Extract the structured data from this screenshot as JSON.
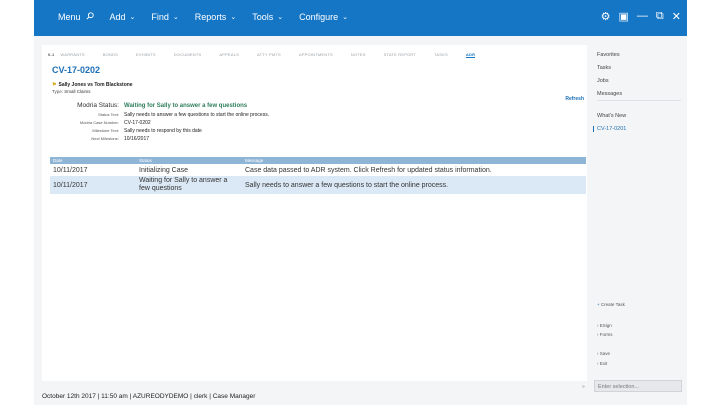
{
  "topbar": {
    "menus": [
      {
        "label": "Menu",
        "icon": "search-icon"
      },
      {
        "label": "Add",
        "icon": "chevron-down-icon"
      },
      {
        "label": "Find",
        "icon": "chevron-down-icon"
      },
      {
        "label": "Reports",
        "icon": "chevron-down-icon"
      },
      {
        "label": "Tools",
        "icon": "chevron-down-icon"
      },
      {
        "label": "Configure",
        "icon": "chevron-down-icon"
      }
    ],
    "window_controls": [
      "gear-icon",
      "screenshot-icon",
      "minimize-icon",
      "restore-icon",
      "close-icon"
    ],
    "color": "#1576c6"
  },
  "tabs": [
    "0-1",
    "WARRANTS",
    "BONDS",
    "EXHIBITS",
    "DOCUMENTS",
    "APPEALS",
    "ATTY PMTS",
    "APPOINTMENTS",
    "NOTES",
    "STATE REPORT",
    "TASKS",
    "ADR"
  ],
  "active_tab": "ADR",
  "case": {
    "number": "CV-17-0202",
    "parties": "Sally Jones vs Tom Blackstone",
    "type_label": "Type:",
    "type_value": "Small Claims"
  },
  "refresh_label": "Refresh",
  "details": {
    "modria_status_label": "Modria Status:",
    "modria_status_value": "Waiting for Sally to answer a few questions",
    "status_text_label": "Status Text:",
    "status_text_value": "Sally needs to answer a few questions to start the online process.",
    "case_number_label": "Modria Case Number:",
    "case_number_value": "CV-17-0202",
    "milestone_text_label": "Milestone Text:",
    "milestone_text_value": "Sally needs to respond by this date",
    "next_milestone_label": "Next Milestone:",
    "next_milestone_value": "10/16/2017"
  },
  "table": {
    "headers": [
      "Date",
      "Status",
      "Message"
    ],
    "rows": [
      [
        "10/11/2017",
        "Initializing Case",
        "Case data passed to ADR system. Click Refresh for updated status information."
      ],
      [
        "10/11/2017",
        "Waiting for Sally to answer a few questions",
        "Sally needs to answer a few questions to start the online process."
      ]
    ]
  },
  "right_pane": {
    "top_items": [
      "Favorites",
      "Tasks",
      "Jobs",
      "Messages"
    ],
    "whats_new": "What's New",
    "recent_case": "CV-17-0201",
    "actions": [
      "Create Task",
      "ESign",
      "Forms",
      "Save",
      "Exit"
    ],
    "enter_selection_placeholder": "Enter selection..."
  },
  "statusbar": {
    "date": "October 12th 2017",
    "time": "11:50 am",
    "server": "AZUREODYDEMO",
    "user": "clerk",
    "app": "Case Manager"
  }
}
